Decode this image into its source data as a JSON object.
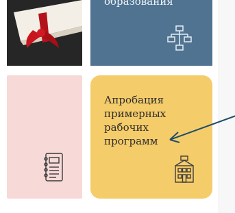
{
  "tiles": {
    "education": {
      "title": "образования",
      "icon": "org-chart-icon"
    },
    "approbation": {
      "title": "Апробация примерных рабочих программ",
      "icon": "building-icon"
    },
    "diploma": {
      "icon": "diploma-scroll-image"
    },
    "pink": {
      "icon": "notebook-icon"
    }
  },
  "annotation": {
    "icon": "arrow-icon",
    "color": "#1f4e6b"
  },
  "colors": {
    "education_bg": "#4f7391",
    "pink_bg": "#f7d9d7",
    "yellow_bg": "#f5cc6a"
  }
}
